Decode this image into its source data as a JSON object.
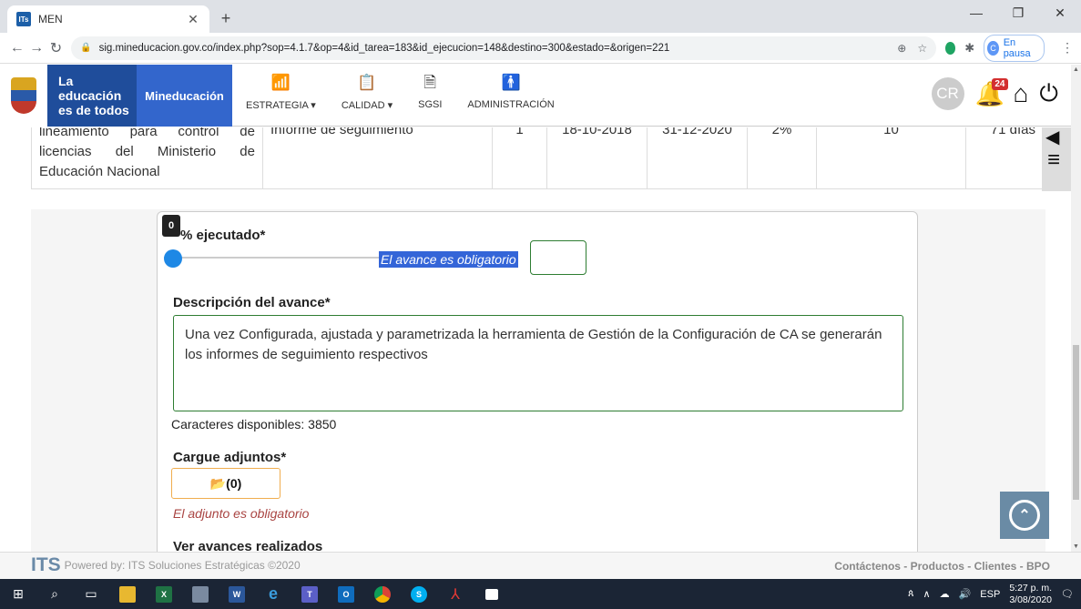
{
  "browser": {
    "tab_title": "MEN",
    "tab_favicon": "ITs",
    "url": "sig.mineducacion.gov.co/index.php?sop=4.1.7&op=4&id_tarea=183&id_ejecucion=148&destino=300&estado=&origen=221",
    "profile_initial": "C",
    "profile_status": "En pausa"
  },
  "header": {
    "logo_line1": "La educación",
    "logo_line2": "es de todos",
    "logo_brand": "Mineducación",
    "menu": [
      {
        "label": "ESTRATEGIA ▾",
        "icon": "chart-icon"
      },
      {
        "label": "CALIDAD ▾",
        "icon": "clipboard-icon"
      },
      {
        "label": "SGSI",
        "icon": "document-lock-icon"
      },
      {
        "label": "ADMINISTRACIÓN",
        "icon": "admin-user-icon"
      }
    ],
    "user_initials": "CR",
    "notification_count": "24"
  },
  "table_row": {
    "c1": "lineamiento para control de licencias del Ministerio de Educación Nacional",
    "c2": "Informe de seguimiento",
    "c3": "1",
    "c4": "18-10-2018",
    "c5": "31-12-2020",
    "c6": "2%",
    "c7": "10",
    "c8": "71 días"
  },
  "form": {
    "executed_label": "% ejecutado*",
    "slider_value": "0",
    "progress_required": "El avance es obligatorio",
    "description_label": "Descripción del avance*",
    "description_value": "Una vez Configurada, ajustada y parametrizada la herramienta de Gestión de la Configuración de CA se generarán los informes de seguimiento respectivos",
    "chars_available": "Caracteres disponibles: 3850",
    "attachments_label": "Cargue adjuntos*",
    "attachments_button": "(0)",
    "attachments_error": "El adjunto es obligatorio",
    "view_progress": "Ver avances realizados"
  },
  "footer": {
    "powered_by": "Powered by: ITS Soluciones Estratégicas ©2020",
    "links": "Contáctenos - Productos - Clientes - BPO"
  },
  "taskbar": {
    "language": "ESP",
    "time": "5:27 p. m.",
    "date": "3/08/2020"
  }
}
